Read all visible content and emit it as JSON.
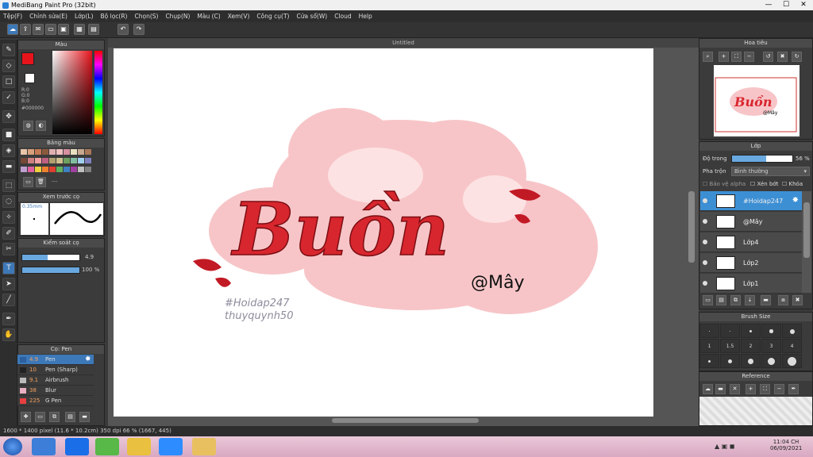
{
  "window": {
    "title": "MediBang Paint Pro (32bit)",
    "minimize": "—",
    "maximize": "☐",
    "close": "✕"
  },
  "menu": [
    "Tệp(F)",
    "Chỉnh sửa(E)",
    "Lớp(L)",
    "Bộ lọc(R)",
    "Chọn(S)",
    "Chụp(N)",
    "Màu (C)",
    "Xem(V)",
    "Công cụ(T)",
    "Cửa sổ(W)",
    "Cloud",
    "Help"
  ],
  "color_panel": {
    "title": "Màu",
    "r": "R:0",
    "g": "G:0",
    "b": "B:0",
    "hex": "#000000",
    "fg": "#e8141c",
    "bg": "#ffffff"
  },
  "palette_panel": {
    "title": "Bảng màu",
    "entry": "---",
    "colors": [
      "#e8c4a8",
      "#d9a07c",
      "#c47a54",
      "#8a5a3c",
      "#e0b0b0",
      "#f0c0c0",
      "#d890a0",
      "#e8e0c0",
      "#c8a890",
      "#a87858",
      "#784838",
      "#d08080",
      "#f0a0a0",
      "#c06080",
      "#b0a070",
      "#d0c090",
      "#70a060",
      "#80c0a0",
      "#a0d0f0",
      "#8080c0",
      "#c0a0d0",
      "#e060a0",
      "#f0d040",
      "#f08030",
      "#e04030",
      "#60b060",
      "#4080c0",
      "#a040a0",
      "#c0c0c0",
      "#808080"
    ]
  },
  "brush_preview_panel": {
    "title": "Xem trước cọ",
    "size": "0.35mm"
  },
  "brush_control_panel": {
    "title": "Kiểm soát cọ",
    "size_value": "4.9",
    "opacity_value": "100 %",
    "opacity_fraction": 1.0,
    "size_fraction": 0.45
  },
  "brush_panel": {
    "title": "Cọ: Pen",
    "items": [
      {
        "size": "4.9",
        "name": "Pen",
        "color": "#2b5fa0",
        "active": true
      },
      {
        "size": "10",
        "name": "Pen (Sharp)",
        "color": "#222222",
        "active": false
      },
      {
        "size": "9.1",
        "name": "Airbrush",
        "color": "#bbbbbb",
        "active": false
      },
      {
        "size": "38",
        "name": "Blur",
        "color": "#e8b0c0",
        "active": false
      },
      {
        "size": "225",
        "name": "G Pen",
        "color": "#e84040",
        "active": false
      }
    ]
  },
  "canvas": {
    "tab_title": "Untitled",
    "main_text": "Buồn",
    "signature": "@Mây",
    "watermark_line1": "#Hoidap247",
    "watermark_line2": "thuyquynh50"
  },
  "navigator": {
    "title": "Hoa tiêu",
    "thumb_text": "Buồn",
    "thumb_sig": "@Mây"
  },
  "layer_panel": {
    "title": "Lớp",
    "opacity_label": "Độ trong",
    "opacity_value": "56 %",
    "opacity_fraction": 0.56,
    "blend_label": "Pha trộn",
    "blend_value": "Bình thường",
    "protect_alpha": "Bảo vệ alpha",
    "clipping": "Xén bớt",
    "lock": "Khóa",
    "layers": [
      {
        "name": "#Hoidap247",
        "active": true
      },
      {
        "name": "@Mây",
        "active": false
      },
      {
        "name": "Lớp4",
        "active": false
      },
      {
        "name": "Lớp2",
        "active": false
      },
      {
        "name": "Lớp1",
        "active": false
      }
    ]
  },
  "brush_size_panel": {
    "title": "Brush Size",
    "labels": [
      "1",
      "1.5",
      "2",
      "3",
      "4"
    ]
  },
  "reference_panel": {
    "title": "Reference"
  },
  "status": {
    "text": "1600 * 1400 pixel  (11.6 * 10.2cm)  350 dpi  66 %  (1667, 445)"
  },
  "taskbar": {
    "time": "11:04 CH",
    "date": "06/09/2021"
  }
}
